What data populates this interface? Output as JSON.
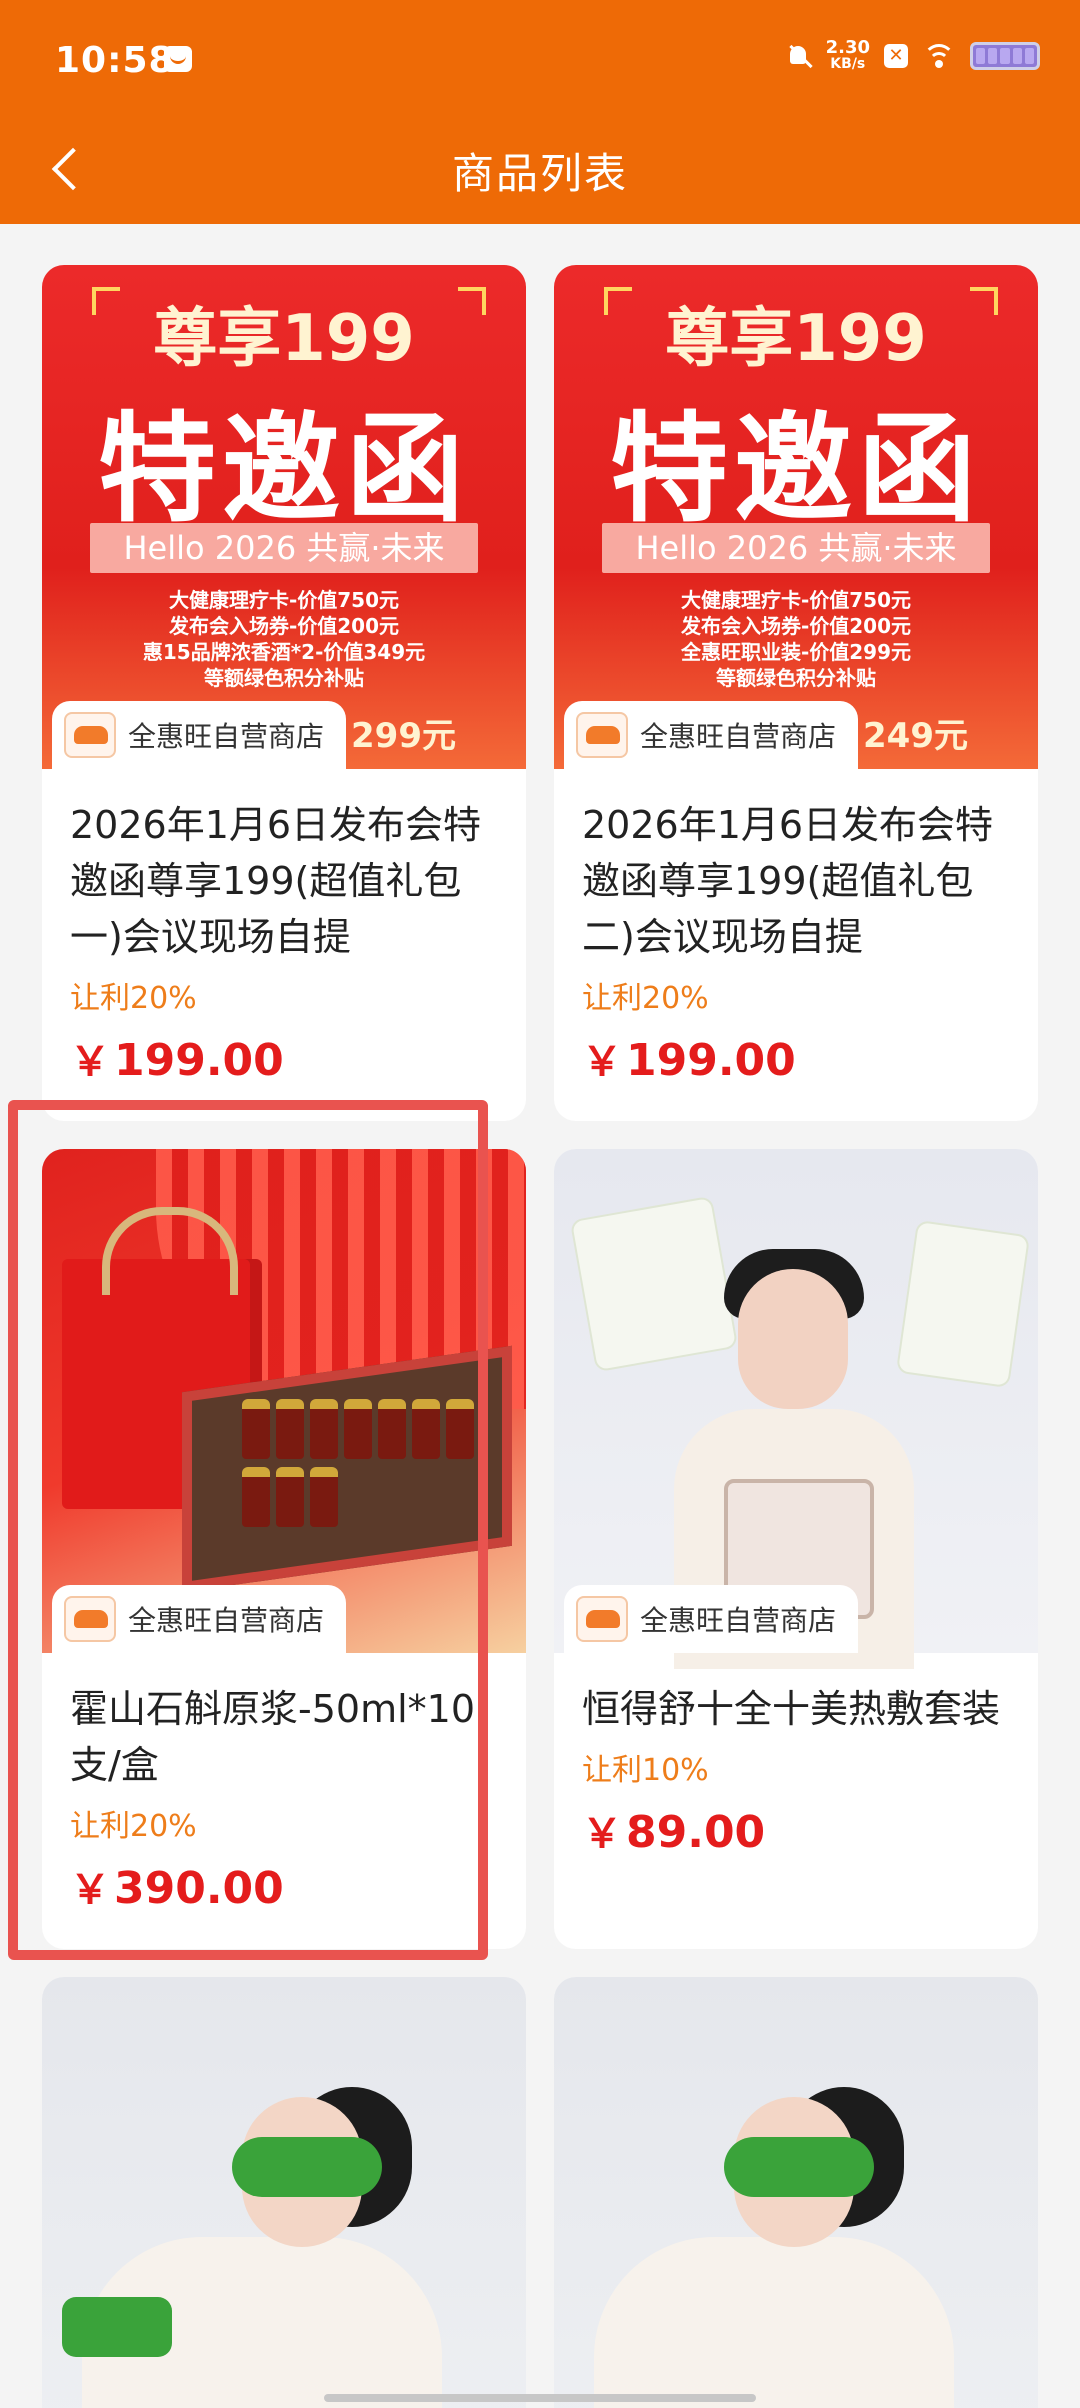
{
  "status_bar": {
    "time": "10:58",
    "net_speed": "2.30",
    "net_unit": "KB/s"
  },
  "header": {
    "title": "商品列表"
  },
  "store_name": "全惠旺自营商店",
  "promo_cards": [
    {
      "line1": "尊享199",
      "line2": "特邀函",
      "bar": "Hello 2026  共赢·未来",
      "lines": [
        "大健康理疗卡-价值750元",
        "发布会入场券-价值200元",
        "惠15品牌浓香酒*2-价值349元",
        "等额绿色积分补贴"
      ],
      "bottom": "299元"
    },
    {
      "line1": "尊享199",
      "line2": "特邀函",
      "bar": "Hello 2026  共赢·未来",
      "lines": [
        "大健康理疗卡-价值750元",
        "发布会入场券-价值200元",
        "全惠旺职业装-价值299元",
        "等额绿色积分补贴"
      ],
      "bottom": "249元"
    }
  ],
  "products": [
    {
      "name": "2026年1月6日发布会特邀函尊享199(超值礼包一)会议现场自提",
      "discount": "让利20%",
      "price": "199.00"
    },
    {
      "name": "2026年1月6日发布会特邀函尊享199(超值礼包二)会议现场自提",
      "discount": "让利20%",
      "price": "199.00"
    },
    {
      "name": "霍山石斛原浆-50ml*10支/盒",
      "discount": "让利20%",
      "price": "390.00"
    },
    {
      "name": "恒得舒十全十美热敷套装",
      "discount": "让利10%",
      "price": "89.00"
    }
  ],
  "currency_symbol": "￥",
  "colors": {
    "brand_orange": "#ee6a06",
    "price_red": "#e41c1c",
    "discount_orange": "#ee7d1a",
    "highlight_red": "#e9534f"
  }
}
